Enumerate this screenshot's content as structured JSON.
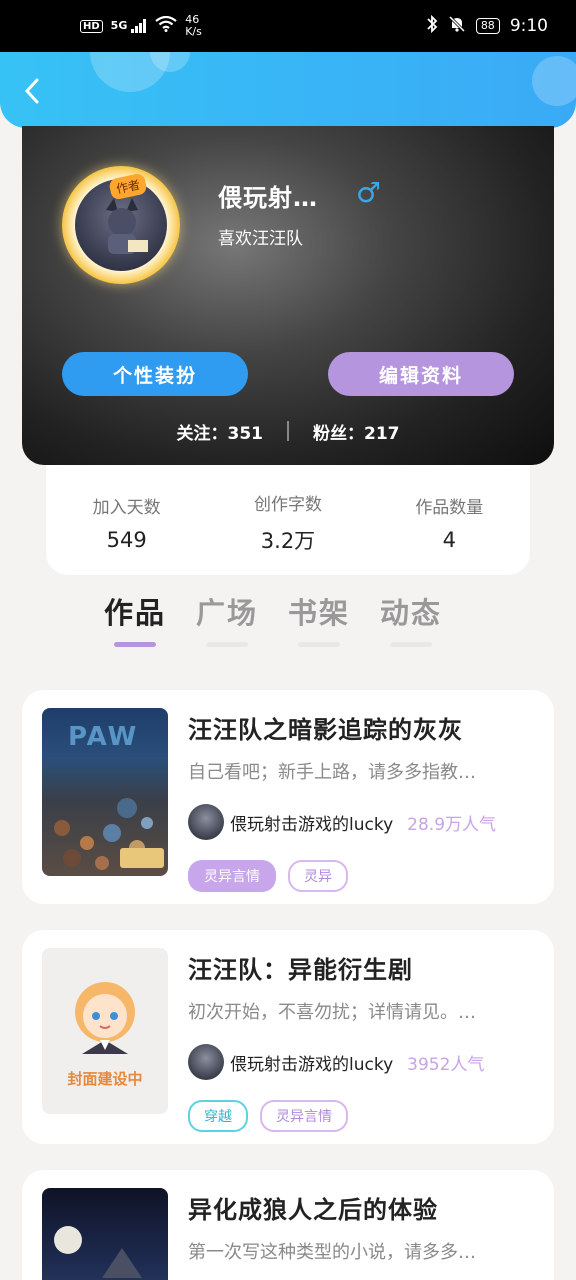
{
  "status_bar": {
    "network_badge": "HD",
    "signal": "5G",
    "speed_value": "46",
    "speed_unit": "K/s",
    "battery": "88",
    "time": "9:10"
  },
  "header": {
    "back_icon": "chevron-left-icon"
  },
  "profile": {
    "author_badge": "作者",
    "username": "偎玩射…",
    "gender_symbol": "♂",
    "bio": "喜欢汪汪队",
    "dress_button": "个性装扮",
    "edit_button": "编辑资料",
    "following_label": "关注：351",
    "fans_label": "粉丝：217"
  },
  "stats": [
    {
      "label": "加入天数",
      "value": "549"
    },
    {
      "label": "创作字数",
      "value": "3.2万"
    },
    {
      "label": "作品数量",
      "value": "4"
    }
  ],
  "tabs": [
    {
      "label": "作品",
      "active": true
    },
    {
      "label": "广场",
      "active": false
    },
    {
      "label": "书架",
      "active": false
    },
    {
      "label": "动态",
      "active": false
    }
  ],
  "books": [
    {
      "title": "汪汪队之暗影追踪的灰灰",
      "description": "自己看吧；新手上路，请多多指教…",
      "author": "偎玩射击游戏的lucky",
      "popularity": "28.9万人气",
      "tags": [
        "灵异言情",
        "灵异"
      ],
      "cover_text": "PAW"
    },
    {
      "title": "汪汪队：异能衍生剧",
      "description": "初次开始，不喜勿扰；详情请见。…",
      "author": "偎玩射击游戏的lucky",
      "popularity": "3952人气",
      "tags": [
        "穿越",
        "灵异言情"
      ],
      "cover_text": "封面建设中"
    },
    {
      "title": "异化成狼人之后的体验",
      "description": "第一次写这种类型的小说，请多多…"
    }
  ],
  "colors": {
    "header": "#37c2f5",
    "dress_button": "#2f9cf2",
    "edit_button": "#b595de",
    "tab_underline": "#b595de",
    "popularity": "#c9a3e8"
  }
}
